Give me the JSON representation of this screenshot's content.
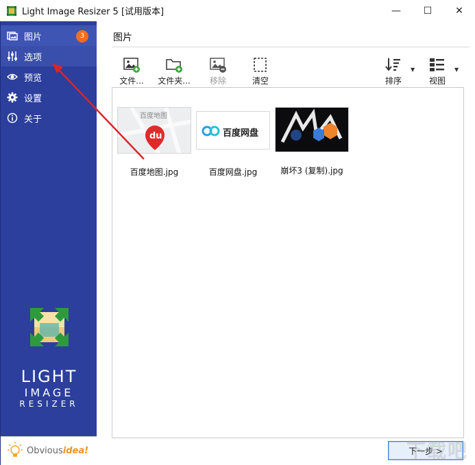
{
  "window": {
    "title": "Light Image Resizer 5  [试用版本]",
    "minimize": "—",
    "maximize": "☐",
    "close": "✕"
  },
  "sidebar": {
    "items": [
      {
        "label": "图片",
        "icon": "images-icon",
        "badge": "3"
      },
      {
        "label": "选项",
        "icon": "sliders-icon"
      },
      {
        "label": "预览",
        "icon": "eye-icon"
      },
      {
        "label": "设置",
        "icon": "gear-icon"
      },
      {
        "label": "关于",
        "icon": "info-icon"
      }
    ],
    "logo": {
      "line1": "LIGHT",
      "line2": "IMAGE",
      "line3": "RESIZER"
    },
    "brand": {
      "prefix": "Obvious",
      "emphasis": "idea!"
    }
  },
  "main": {
    "section_title": "图片",
    "toolbar": {
      "add_file": "文件...",
      "add_folder": "文件夹...",
      "remove": "移除",
      "clear": "清空",
      "sort": "排序",
      "view": "视图"
    },
    "files": [
      {
        "name": "百度地图.jpg",
        "thumb_text": "百度地图",
        "thumb_logo": "du"
      },
      {
        "name": "百度网盘.jpg",
        "thumb_text": "百度网盘"
      },
      {
        "name": "崩坏3 (复制).jpg"
      }
    ],
    "next_button": "下一步 >"
  },
  "watermark": "下载吧",
  "colors": {
    "sidebar": "#2c3f9c",
    "sidebar_active": "#3f55b4",
    "badge": "#f26d21",
    "annotation_arrow": "#d9262b"
  }
}
